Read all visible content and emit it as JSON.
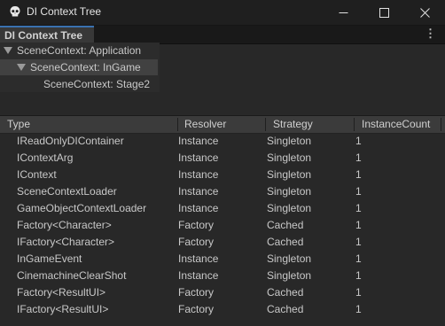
{
  "window": {
    "title": "DI Context Tree"
  },
  "tab": {
    "label": "DI Context Tree"
  },
  "tree": [
    {
      "label": "SceneContext: Application",
      "expanded": true,
      "selected": false
    },
    {
      "label": "SceneContext: InGame",
      "expanded": true,
      "selected": true
    },
    {
      "label": "SceneContext: Stage2",
      "expanded": false,
      "selected": false
    }
  ],
  "table": {
    "columns": [
      "Type",
      "Resolver",
      "Strategy",
      "InstanceCount"
    ],
    "rows": [
      [
        "IReadOnlyDIContainer",
        "Instance",
        "Singleton",
        "1"
      ],
      [
        "IContextArg",
        "Instance",
        "Singleton",
        "1"
      ],
      [
        "IContext",
        "Instance",
        "Singleton",
        "1"
      ],
      [
        "SceneContextLoader",
        "Instance",
        "Singleton",
        "1"
      ],
      [
        "GameObjectContextLoader",
        "Instance",
        "Singleton",
        "1"
      ],
      [
        "Factory<Character>",
        "Factory",
        "Cached",
        "1"
      ],
      [
        "IFactory<Character>",
        "Factory",
        "Cached",
        "1"
      ],
      [
        "InGameEvent",
        "Instance",
        "Singleton",
        "1"
      ],
      [
        "CinemachineClearShot",
        "Instance",
        "Singleton",
        "1"
      ],
      [
        "Factory<ResultUI>",
        "Factory",
        "Cached",
        "1"
      ],
      [
        "IFactory<ResultUI>",
        "Factory",
        "Cached",
        "1"
      ]
    ]
  },
  "icons": {
    "app": "unity-logo-icon",
    "minimize": "minimize-icon",
    "maximize": "maximize-icon",
    "close": "close-icon",
    "menu": "kebab-menu-icon",
    "expand": "expand-arrow-icon"
  },
  "colors": {
    "background": "#282828",
    "titlebar": "#1f1f1f",
    "tab_accent": "#3a72b0",
    "selected_row": "#414141",
    "header": "#3b3b3b"
  }
}
